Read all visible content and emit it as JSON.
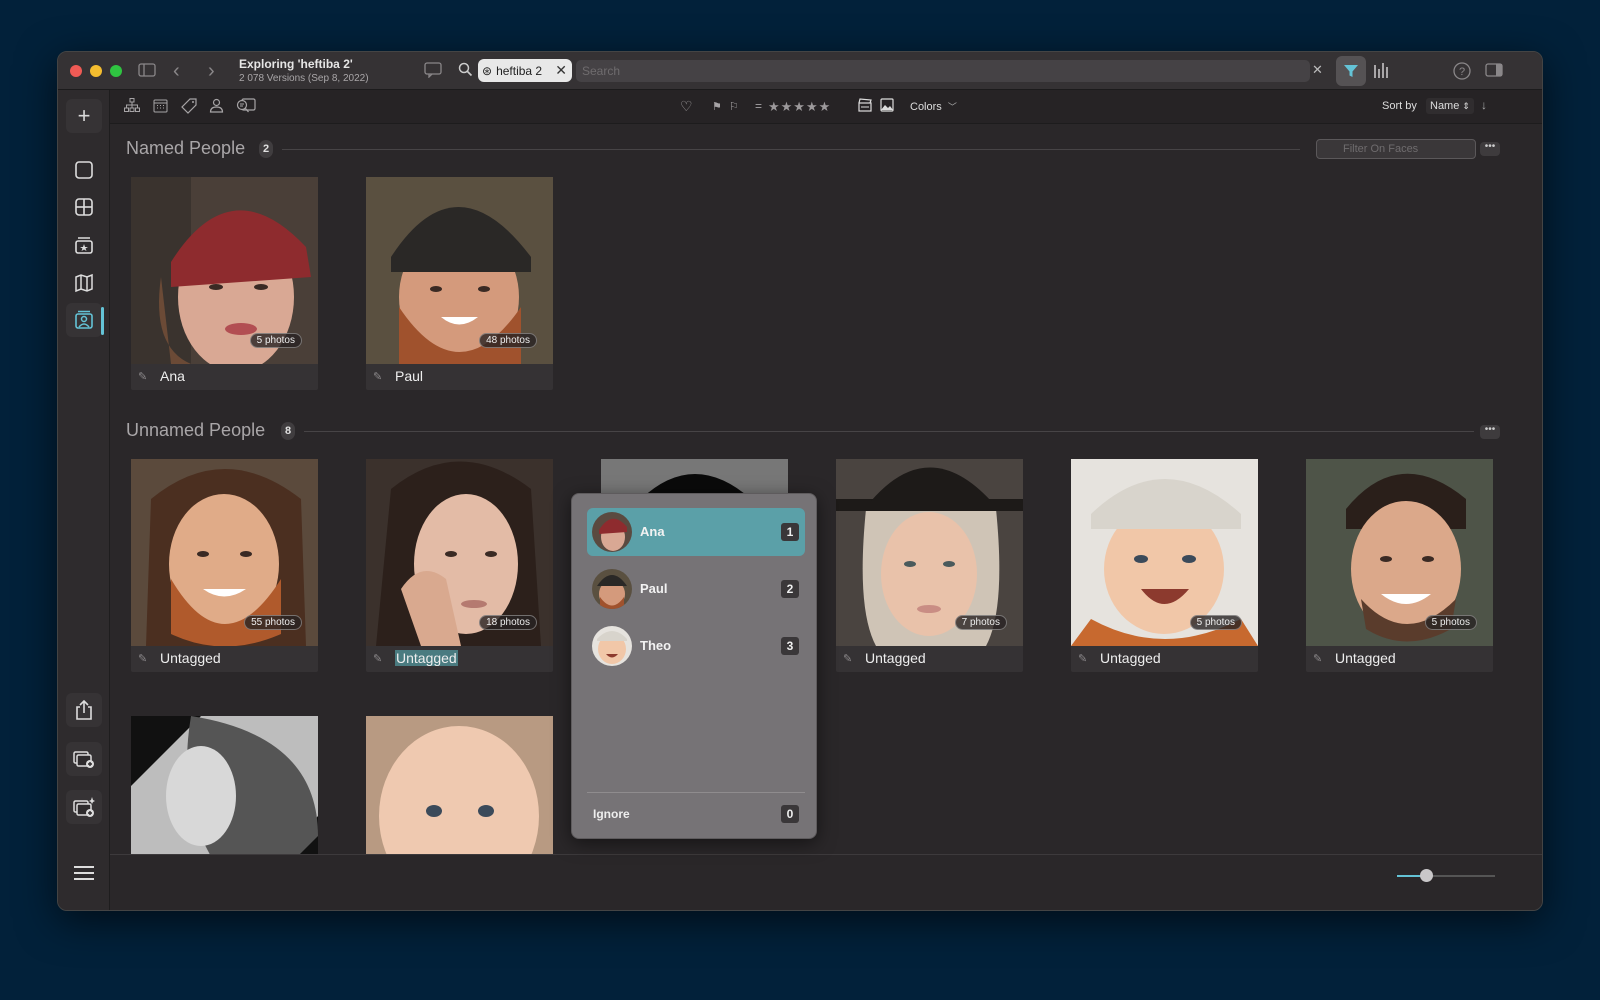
{
  "window": {
    "title": "Exploring 'heftiba 2'",
    "subtitle": "2 078 Versions (Sep 8, 2022)"
  },
  "titlebar": {
    "search_chip_label": "heftiba 2",
    "search_placeholder": "Search",
    "clear_label": "✕",
    "filter_active": true,
    "accent_color": "#64c3d6"
  },
  "toolbar": {
    "rating_prefix": "=",
    "stars": "★★★★★",
    "colors_label": "Colors",
    "sort_label": "Sort by",
    "sort_value": "Name",
    "sort_value_suffix": "⌃"
  },
  "sections": {
    "named": {
      "title": "Named People",
      "count": "2",
      "filter_placeholder": "Filter On Faces",
      "more_label": "•••",
      "people": [
        {
          "name": "Ana",
          "photos": "5 photos"
        },
        {
          "name": "Paul",
          "photos": "48 photos"
        }
      ]
    },
    "unnamed": {
      "title": "Unnamed People",
      "count": "8",
      "more_label": "•••",
      "people": [
        {
          "name": "Untagged",
          "photos": "55 photos"
        },
        {
          "name": "Untagged",
          "photos": "18 photos",
          "editing": true
        },
        {
          "name": "",
          "photos": ""
        },
        {
          "name": "Untagged",
          "photos": "7 photos"
        },
        {
          "name": "Untagged",
          "photos": "5 photos"
        },
        {
          "name": "Untagged",
          "photos": "5 photos"
        },
        {
          "name": "",
          "photos": ""
        },
        {
          "name": "",
          "photos": ""
        }
      ]
    }
  },
  "popup": {
    "items": [
      {
        "name": "Ana",
        "key": "1",
        "selected": true
      },
      {
        "name": "Paul",
        "key": "2"
      },
      {
        "name": "Theo",
        "key": "3"
      }
    ],
    "ignore": {
      "label": "Ignore",
      "key": "0"
    }
  },
  "zoom_slider": {
    "value_fraction": 0.3
  }
}
